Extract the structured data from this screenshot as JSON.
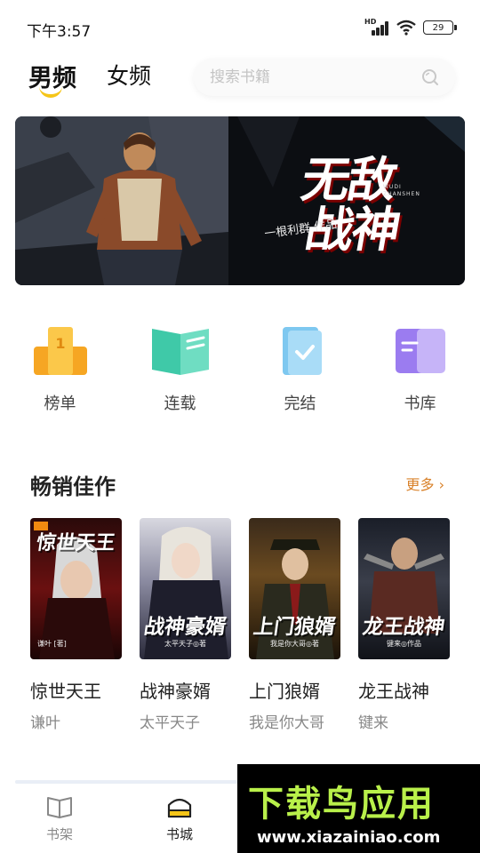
{
  "status_bar": {
    "time": "下午3:57",
    "signal_label": "HD",
    "battery": "29"
  },
  "header": {
    "tabs": [
      {
        "label": "男频",
        "active": true
      },
      {
        "label": "女频",
        "active": false
      }
    ],
    "search_placeholder": "搜索书籍",
    "accent_color": "#f5c518"
  },
  "banner": {
    "title_line1": "无敌",
    "title_line2": "战神",
    "author": "一根利群 作品",
    "subtitle": "WUDI ZHANSHEN"
  },
  "categories": [
    {
      "label": "榜单",
      "icon": "trophy-icon"
    },
    {
      "label": "连载",
      "icon": "open-book-icon"
    },
    {
      "label": "完结",
      "icon": "completed-book-icon"
    },
    {
      "label": "书库",
      "icon": "library-icon"
    }
  ],
  "best_sellers": {
    "title": "畅销佳作",
    "more_label": "更多 ›",
    "books": [
      {
        "name": "惊世天王",
        "author": "谦叶",
        "cover_title": "惊世天王",
        "cover_author": "谦叶 [著]"
      },
      {
        "name": "战神豪婿",
        "author": "太平天子",
        "cover_title": "战神豪婿",
        "cover_author": "太平天子◎著"
      },
      {
        "name": "上门狼婿",
        "author": "我是你大哥",
        "cover_title": "上门狼婿",
        "cover_author": "我是你大哥◎著"
      },
      {
        "name": "龙王战神",
        "author": "键来",
        "cover_title": "龙王战神",
        "cover_author": "键来◎作品"
      }
    ]
  },
  "bottom_nav": [
    {
      "label": "书架",
      "icon": "bookshelf-icon",
      "active": false
    },
    {
      "label": "书城",
      "icon": "bookstore-icon",
      "active": true
    }
  ],
  "watermark": {
    "title": "下载鸟应用",
    "url": "www.xiazainiao.com"
  }
}
